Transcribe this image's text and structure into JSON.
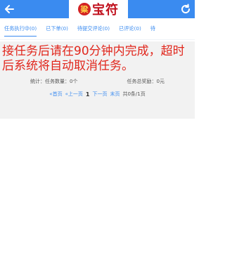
{
  "header": {
    "logo_badge": "粱",
    "logo_text": "宝符"
  },
  "tabs": [
    {
      "label": "任务执行中(0)"
    },
    {
      "label": "已下单(0)"
    },
    {
      "label": "待提交评论(0)"
    },
    {
      "label": "已评论(0)"
    },
    {
      "label": "待"
    }
  ],
  "notice": "接任务后请在90分钟内完成，超时后系统将自动取消任务。",
  "stats": {
    "count_label": "统计：任务数量：0个",
    "reward_label": "任务总奖励：0元"
  },
  "pager": {
    "first": "«首页",
    "prev": "«上一页",
    "current": "1",
    "next": "下一页",
    "last": "末页",
    "summary": "共0条/1页"
  },
  "colors": {
    "header_bg": "#3a8bf0",
    "accent": "#3a8bf0",
    "notice_text": "#e1261c"
  },
  "icons": {
    "back": "arrow-left-icon",
    "refresh": "refresh-icon"
  }
}
